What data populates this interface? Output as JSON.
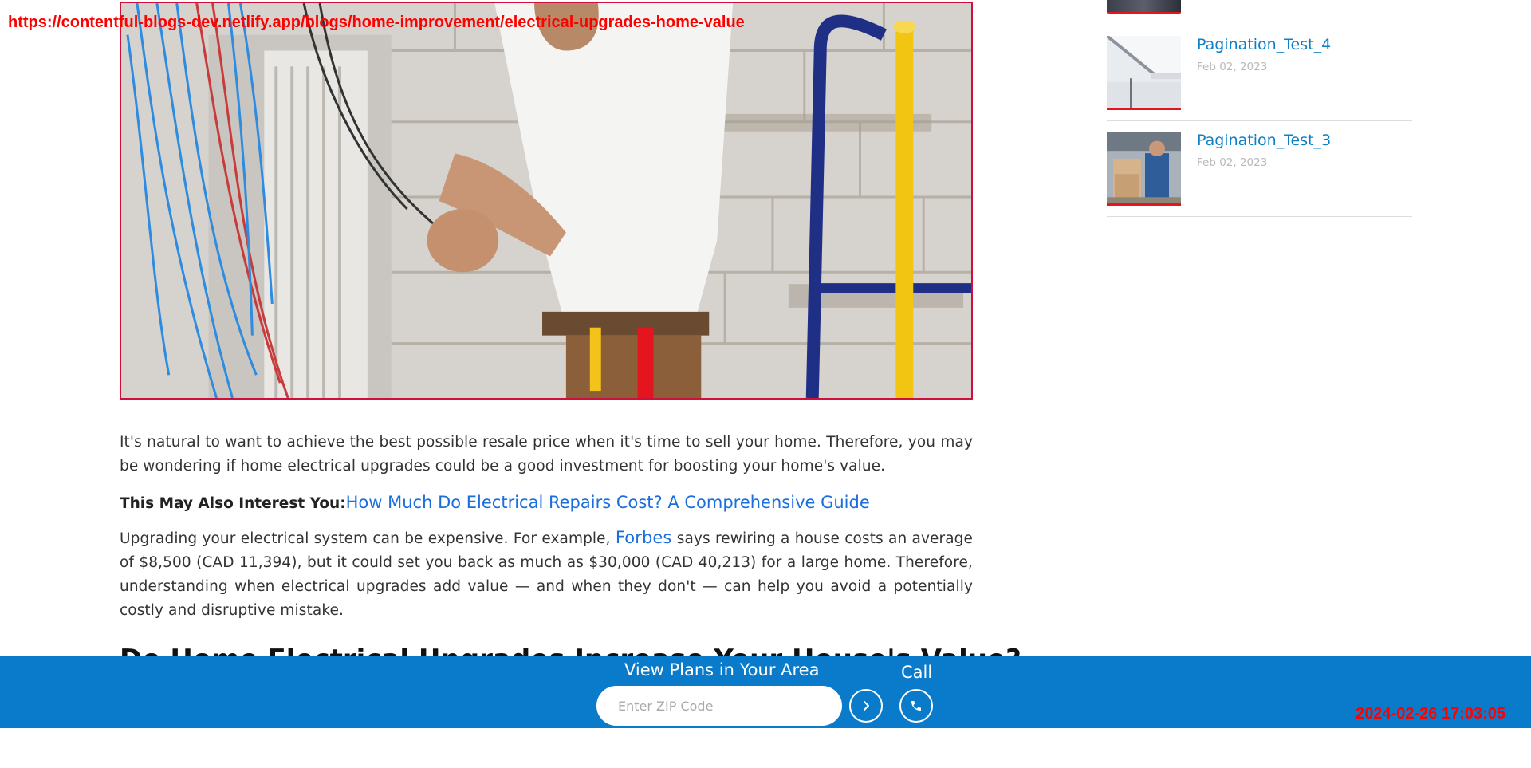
{
  "overlay": {
    "url": "https://contentful-blogs-dev.netlify.app/blogs/home-improvement/electrical-upgrades-home-value",
    "timestamp": "2024-02-26 17:03:05"
  },
  "article": {
    "intro": "It's natural to want to achieve the best possible resale price when it's time to sell your home. Therefore, you may be wondering if home electrical upgrades could be a good investment for boosting your home's value.",
    "interest_label": "This May Also Interest You:",
    "interest_link": "How Much Do Electrical Repairs Cost? A Comprehensive Guide",
    "para2_before": "Upgrading your electrical system can be expensive. For example, ",
    "para2_link": "Forbes",
    "para2_after": " says rewiring a house costs an average of $8,500 (CAD 11,394), but it could set you back as much as $30,000 (CAD 40,213) for a large home. Therefore, understanding when electrical upgrades add value — and when they don't — can help you avoid a potentially costly and disruptive mistake.",
    "heading": "Do Home Electrical Upgrades Increase Your House's Value?"
  },
  "sidebar": {
    "items": [
      {
        "title": "Pagination_Test_4",
        "date": "Feb 02, 2023"
      },
      {
        "title": "Pagination_Test_3",
        "date": "Feb 02, 2023"
      }
    ]
  },
  "bottom_bar": {
    "plans_label": "View Plans in Your Area",
    "zip_placeholder": "Enter ZIP Code",
    "call_label": "Call"
  },
  "colors": {
    "bar_blue": "#0a7acb",
    "link_blue": "#1a6fdc",
    "sidebar_title": "#0d7fc4",
    "accent_red": "#e4151f"
  },
  "icons": {
    "go": "chevron-right-icon",
    "call": "phone-icon"
  }
}
